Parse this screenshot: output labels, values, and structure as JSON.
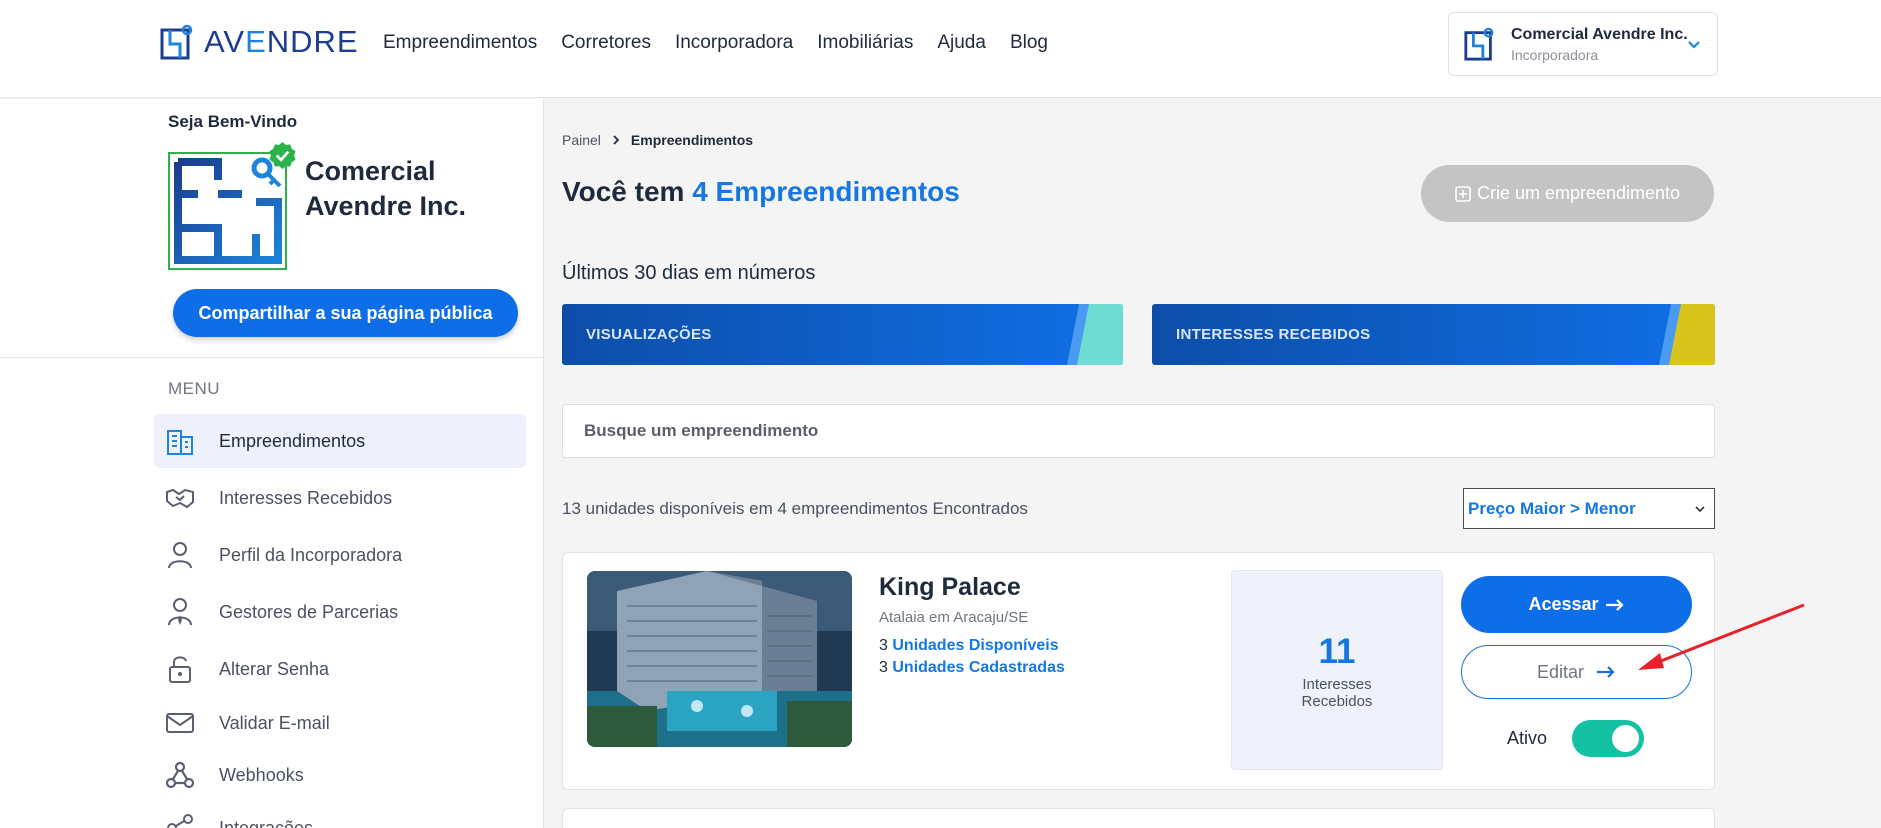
{
  "brand": {
    "prefix": "AV",
    "e": "E",
    "suffix": "NDRE"
  },
  "nav": [
    "Empreendimentos",
    "Corretores",
    "Incorporadora",
    "Imobiliárias",
    "Ajuda",
    "Blog"
  ],
  "account": {
    "name": "Comercial Avendre Inc.",
    "role": "Incorporadora"
  },
  "sidebar": {
    "welcome": "Seja Bem-Vindo",
    "company": "Comercial Avendre Inc.",
    "share_label": "Compartilhar a sua página pública",
    "menu_title": "MENU",
    "items": [
      {
        "label": "Empreendimentos",
        "icon": "building-icon"
      },
      {
        "label": "Interesses Recebidos",
        "icon": "handshake-icon"
      },
      {
        "label": "Perfil da Incorporadora",
        "icon": "user-icon"
      },
      {
        "label": "Gestores de Parcerias",
        "icon": "user-tie-icon"
      },
      {
        "label": "Alterar Senha",
        "icon": "lock-icon"
      },
      {
        "label": "Validar E-mail",
        "icon": "mail-icon"
      },
      {
        "label": "Webhooks",
        "icon": "webhook-icon"
      },
      {
        "label": "Integrações",
        "icon": "share-nodes-icon"
      }
    ]
  },
  "main": {
    "breadcrumb": [
      "Painel",
      "Empreendimentos"
    ],
    "title_prefix": "Você tem ",
    "title_accent": "4 Empreendimentos",
    "create_label": "Crie um empreendimento",
    "stats_title": "Últimos 30 dias em números",
    "stats": [
      {
        "label": "VISUALIZAÇÕES",
        "accent": "#6fdcd1"
      },
      {
        "label": "INTERESSES RECEBIDOS",
        "accent": "#d8c41c"
      }
    ],
    "search_placeholder": "Busque um empreendimento",
    "result_count": "13 unidades disponíveis em 4 empreendimentos Encontrados",
    "sort_selected": "Preço Maior > Menor"
  },
  "listing": {
    "title": "King Palace",
    "location": "Atalaia em Aracaju/SE",
    "available_count": "3",
    "available_label": "Unidades Disponíveis",
    "registered_count": "3",
    "registered_label": "Unidades Cadastradas",
    "interests_count": "11",
    "interests_label_1": "Interesses",
    "interests_label_2": "Recebidos",
    "access_label": "Acessar",
    "edit_label": "Editar",
    "status_label": "Ativo",
    "active": true
  },
  "colors": {
    "primary": "#0d6ee8",
    "accent_text": "#1677e0",
    "toggle": "#14c2a3",
    "annotation": "#e8202a"
  }
}
